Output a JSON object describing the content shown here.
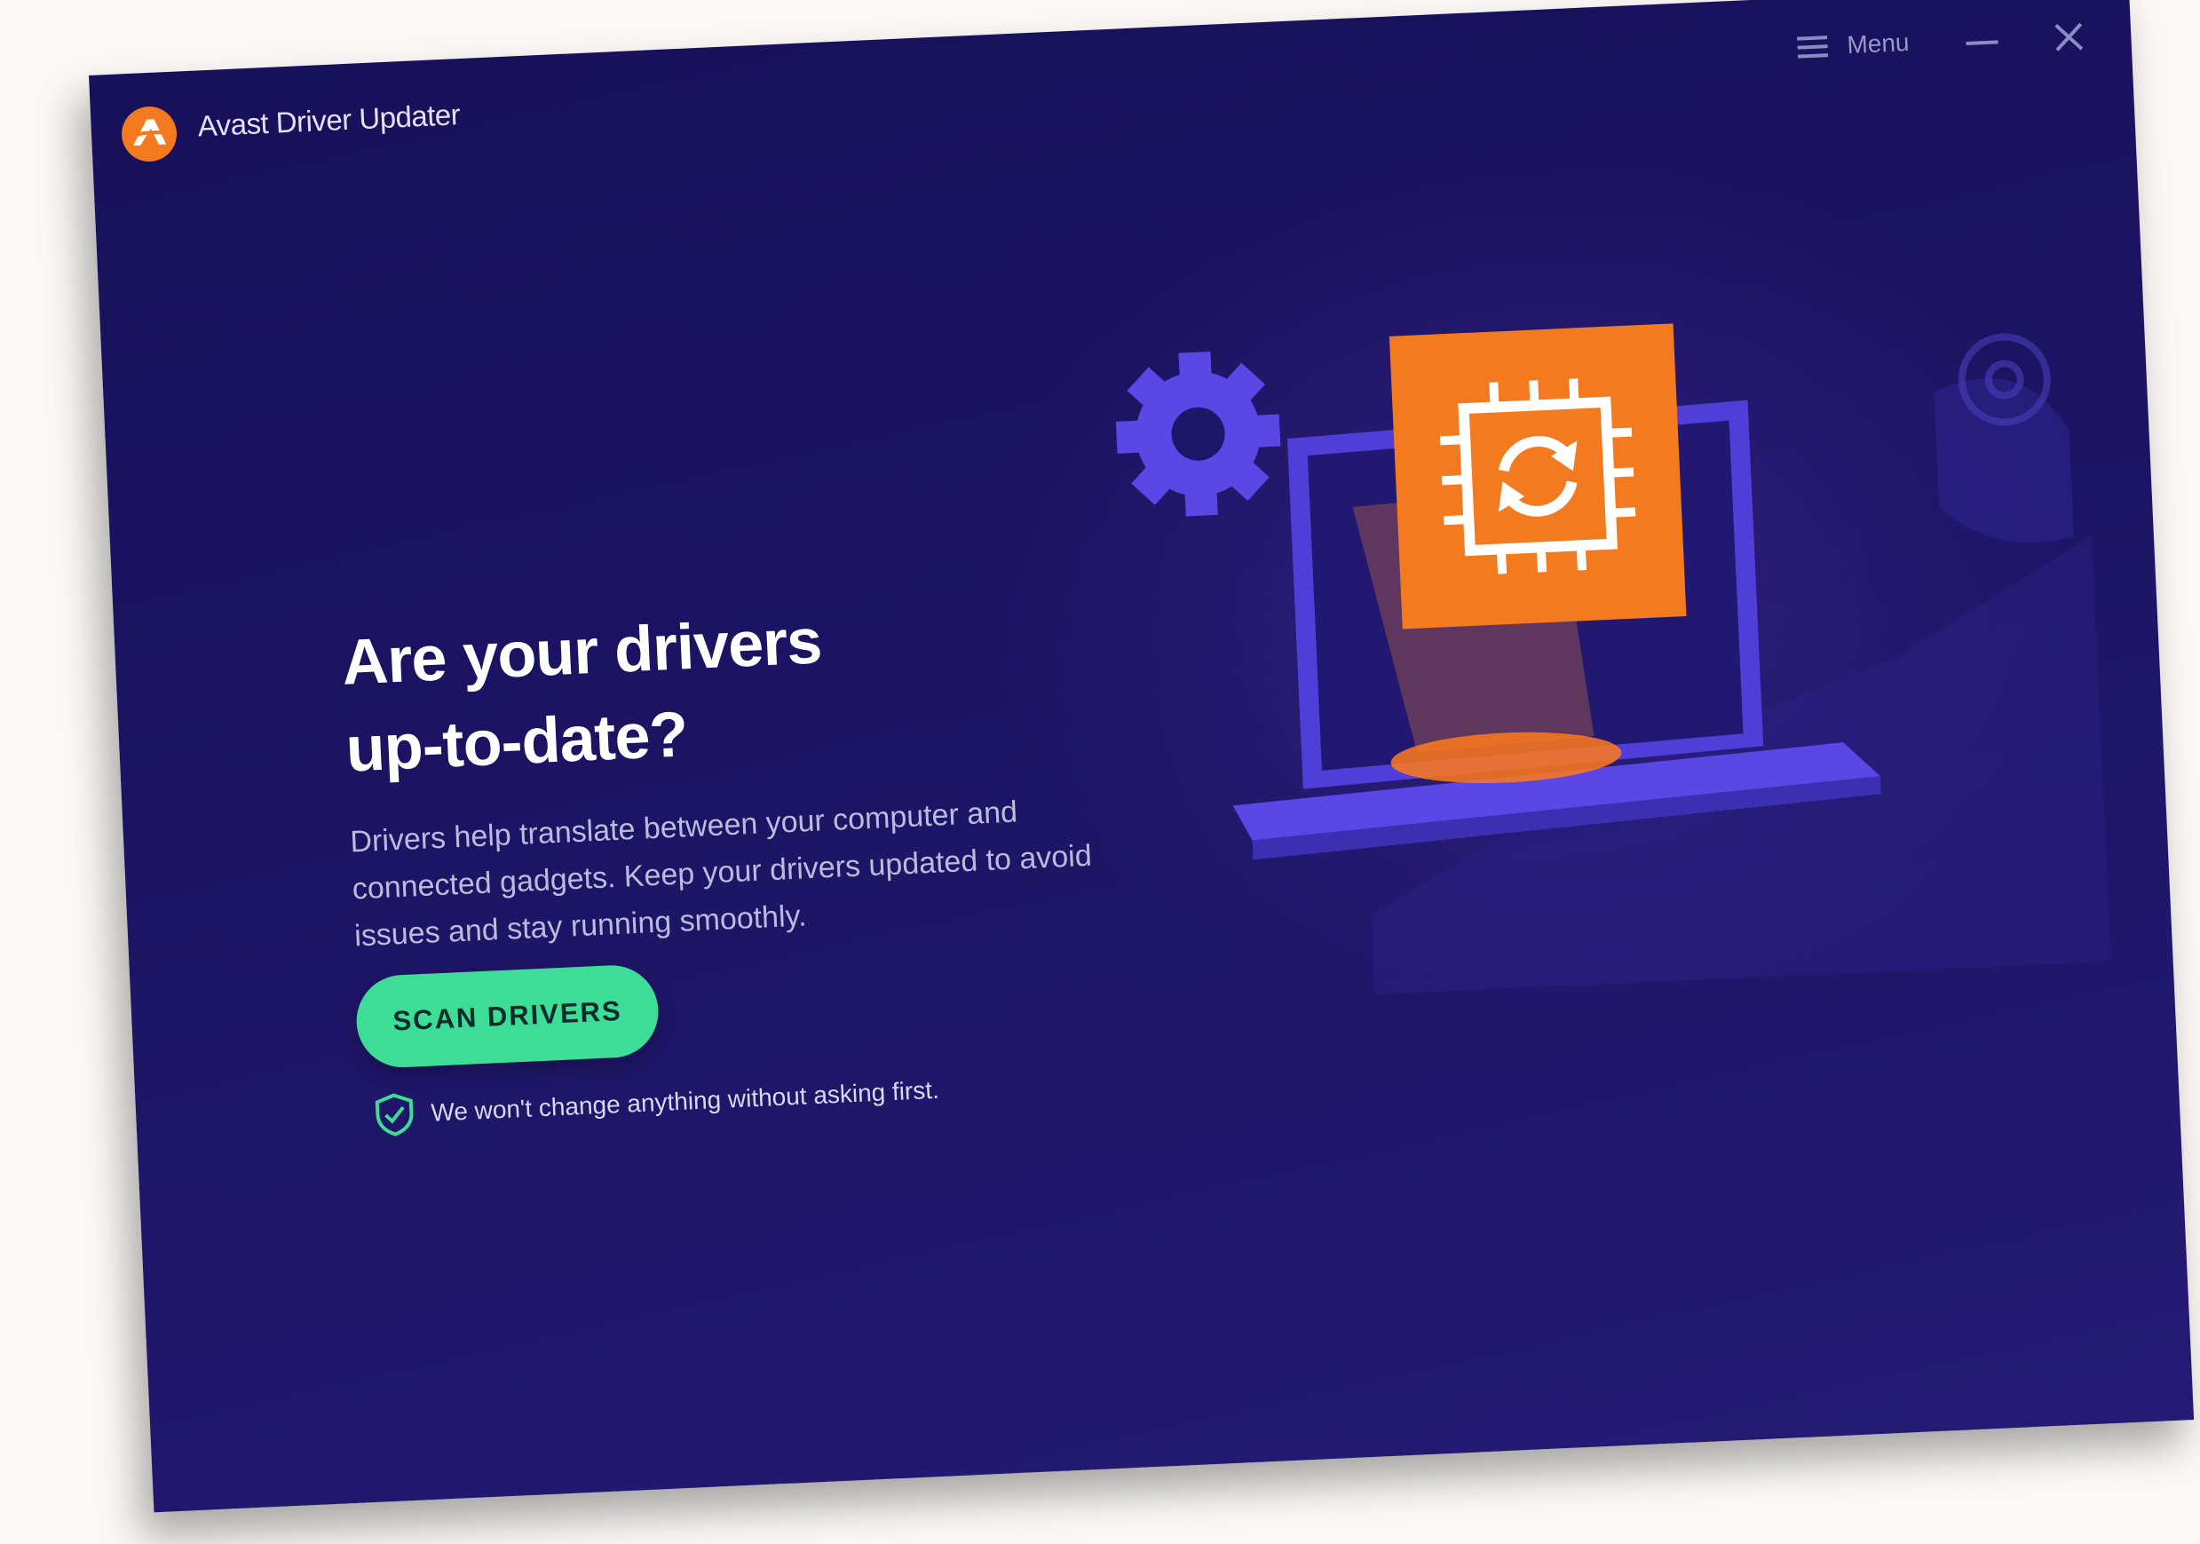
{
  "window": {
    "title": "Avast Driver Updater",
    "menu_label": "Menu"
  },
  "main": {
    "headline_line1": "Are your drivers",
    "headline_line2": "up-to-date?",
    "description": "Drivers help translate between your computer and connected gadgets. Keep your drivers updated to avoid issues and stay running smoothly.",
    "scan_button": "SCAN DRIVERS",
    "assurance_text": "We won't change anything without asking first."
  },
  "colors": {
    "background": "#1c1463",
    "accent_green": "#3ddc97",
    "brand_orange": "#f47a1f",
    "illustration_purple": "#5b47e6"
  },
  "icons": [
    "avast-logo-icon",
    "menu-icon",
    "minimize-icon",
    "close-icon",
    "shield-check-icon",
    "gear-icon",
    "chip-refresh-icon"
  ]
}
